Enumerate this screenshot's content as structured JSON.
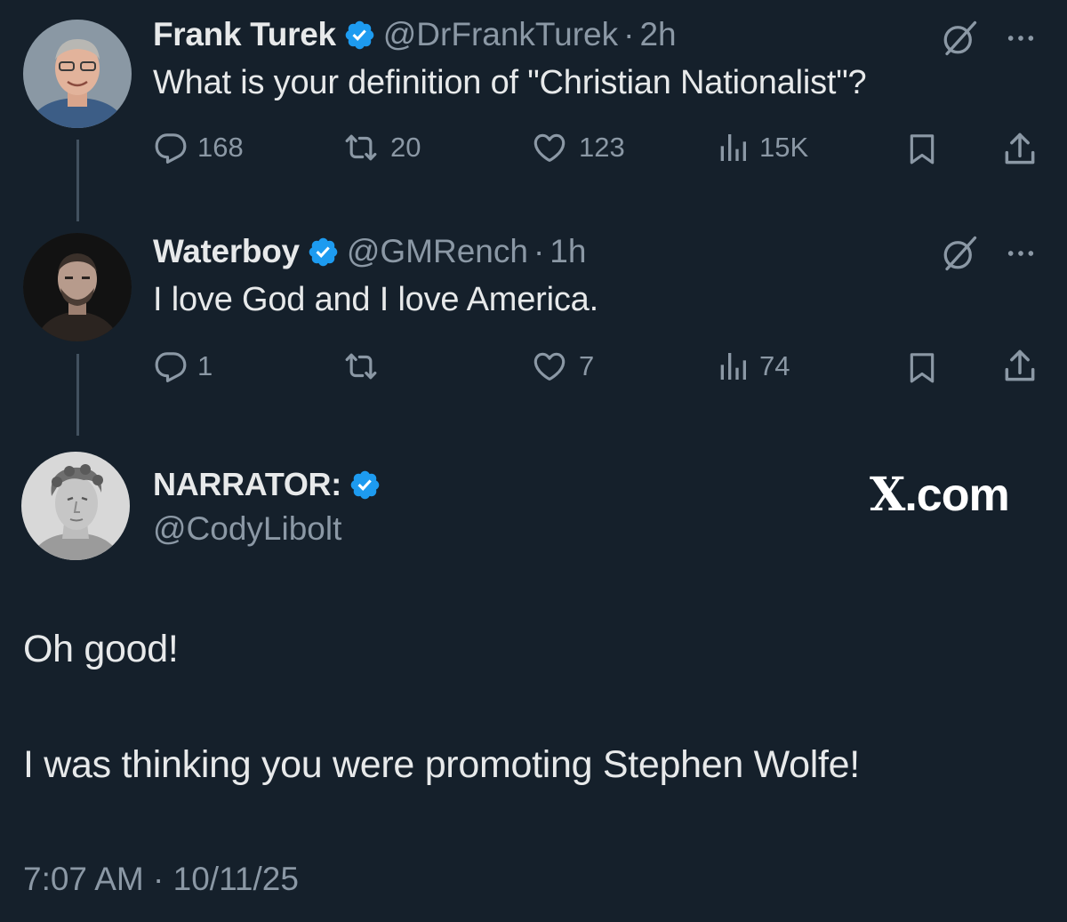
{
  "tweets": [
    {
      "name": "Frank Turek",
      "handle": "@DrFrankTurek",
      "separator": "·",
      "time": "2h",
      "text": "What is your definition of \"Christian Nationalist\"?",
      "replies": "168",
      "reposts": "20",
      "likes": "123",
      "views": "15K"
    },
    {
      "name": "Waterboy",
      "handle": "@GMRench",
      "separator": "·",
      "time": "1h",
      "text": "I love God and I love America.",
      "replies": "1",
      "reposts": "",
      "likes": "7",
      "views": "74"
    }
  ],
  "main": {
    "name": "NARRATOR:",
    "handle": "@CodyLibolt",
    "line1": "Oh good!",
    "line2": "I was thinking you were promoting Stephen Wolfe!",
    "timestamp": "7:07 AM · 10/11/25"
  },
  "watermark": {
    "mark": "X",
    "suffix": ".com"
  },
  "colors": {
    "background": "#15202b",
    "text": "#e7e9ea",
    "muted": "#8b98a5",
    "verified": "#1d9bf0",
    "thread_line": "#42515f"
  },
  "icons": [
    "verified-badge-icon",
    "grok-icon",
    "more-icon",
    "reply-icon",
    "repost-icon",
    "like-icon",
    "views-icon",
    "bookmark-icon",
    "share-icon"
  ]
}
